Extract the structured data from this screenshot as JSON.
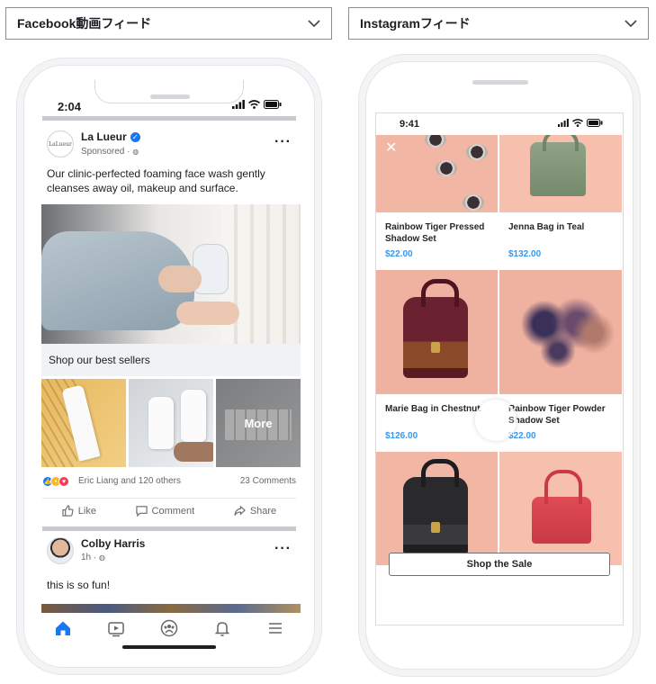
{
  "dropdowns": {
    "left": {
      "label": "Facebook動画フィード"
    },
    "right": {
      "label": "Instagramフィード"
    }
  },
  "facebook": {
    "status_time": "2:04",
    "post": {
      "brand_name": "La Lueur",
      "avatar_text": "LaLueur",
      "sponsored": "Sponsored · ",
      "body": "Our clinic-perfected foaming face wash gently cleanses away oil, makeup and surface.",
      "cta": "Shop our best sellers",
      "more_overlay": "More",
      "reactions_text": "Eric Liang and 120 others",
      "comments_count": "23 Comments",
      "actions": {
        "like": "Like",
        "comment": "Comment",
        "share": "Share"
      }
    },
    "post2": {
      "author": "Colby Harris",
      "meta": "1h · ",
      "body": "this is so fun!"
    },
    "tabbar": [
      "home-icon",
      "watch-icon",
      "groups-icon",
      "notifications-icon",
      "menu-icon"
    ],
    "colors": {
      "accent": "#1877f2",
      "muted": "#65676b"
    }
  },
  "instagram": {
    "status_time": "9:41",
    "close_symbol": "✕",
    "products": [
      {
        "name": "Rainbow Tiger Pressed Shadow Set",
        "price": "$22.00"
      },
      {
        "name": "Jenna Bag in Teal",
        "price": "$132.00"
      },
      {
        "name": "Marie Bag in Chestnut",
        "price": "$126.00"
      },
      {
        "name": "Rainbow Tiger Powder Shadow Set",
        "price": "$22.00"
      }
    ],
    "cta": "Shop the Sale",
    "colors": {
      "price": "#3897f0",
      "tile_bg": "#f2b6a4"
    }
  }
}
